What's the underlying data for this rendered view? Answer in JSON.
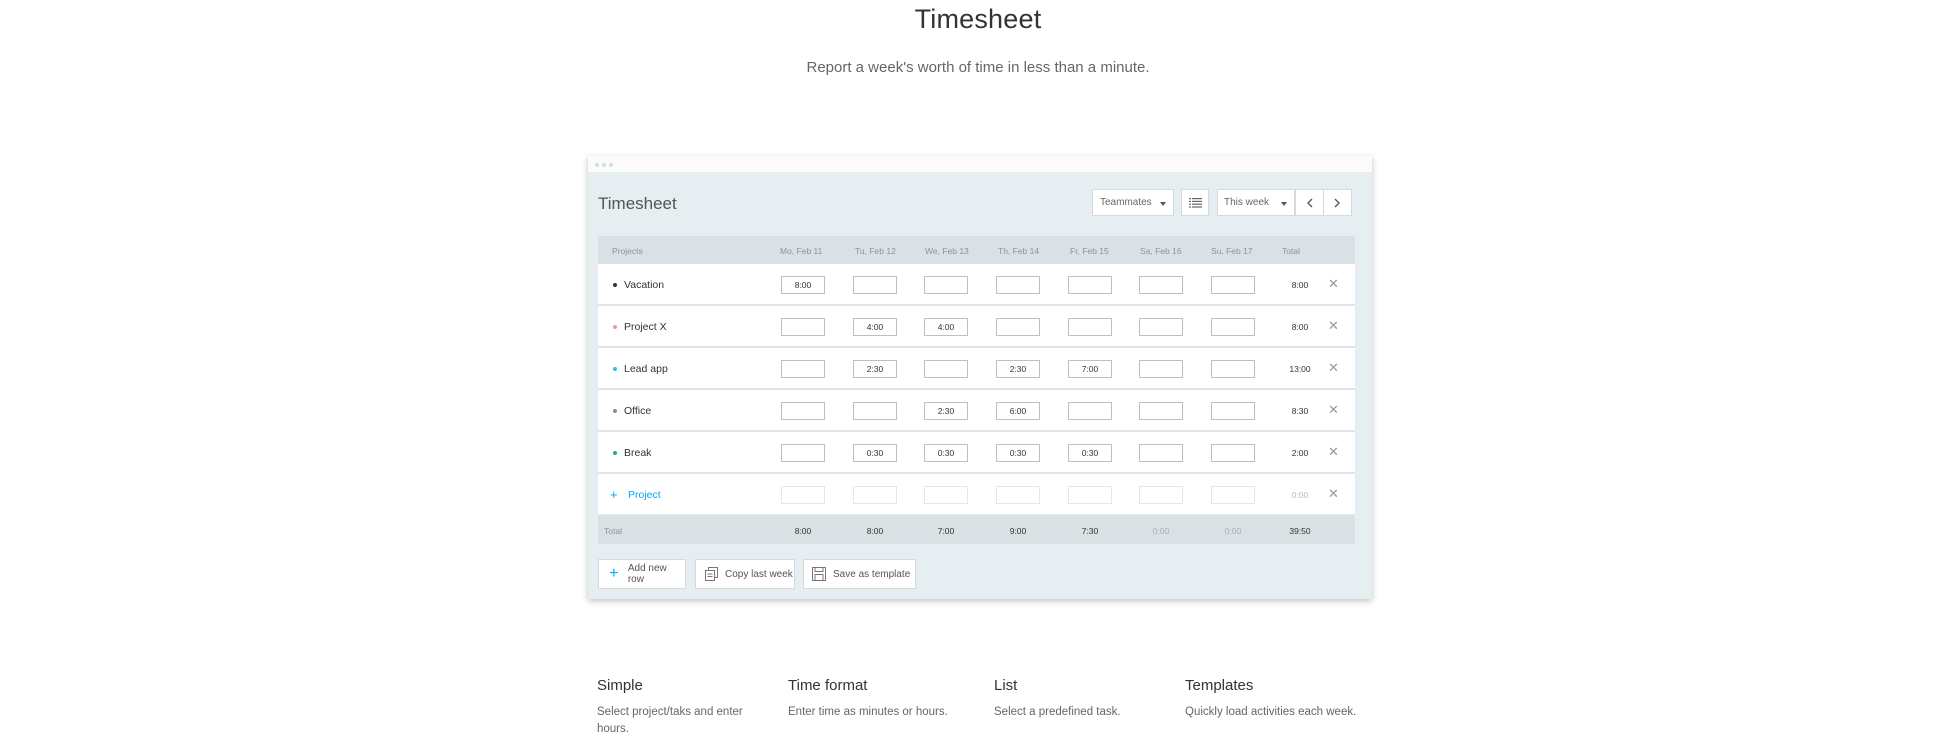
{
  "hero": {
    "title": "Timesheet",
    "subtitle": "Report a week's worth of time in less than a minute."
  },
  "app": {
    "title": "Timesheet",
    "teammates_label": "Teammates",
    "range_label": "This week",
    "prev_icon": "chevron-left-icon",
    "next_icon": "chevron-right-icon",
    "accent_color": "#03a9f4"
  },
  "table": {
    "headers": {
      "projects": "Projects",
      "days": [
        "Mo, Feb 11",
        "Tu, Feb 12",
        "We, Feb 13",
        "Th, Feb 14",
        "Fr, Feb 15",
        "Sa, Feb 16",
        "Su, Feb 17"
      ],
      "total": "Total"
    },
    "rows": [
      {
        "name": "Vacation",
        "color": "#333333",
        "cells": [
          "8:00",
          "",
          "",
          "",
          "",
          "",
          ""
        ],
        "total": "8:00"
      },
      {
        "name": "Project X",
        "color": "#f48fb1",
        "cells": [
          "",
          "4:00",
          "4:00",
          "",
          "",
          "",
          ""
        ],
        "total": "8:00"
      },
      {
        "name": "Lead app",
        "color": "#26c6da",
        "cells": [
          "",
          "2:30",
          "",
          "2:30",
          "7:00",
          "",
          ""
        ],
        "total": "13:00"
      },
      {
        "name": "Office",
        "color": "#a1887f",
        "cells": [
          "",
          "",
          "2:30",
          "6:00",
          "",
          "",
          ""
        ],
        "total": "8:30"
      },
      {
        "name": "Break",
        "color": "#26a69a",
        "cells": [
          "",
          "0:30",
          "0:30",
          "0:30",
          "0:30",
          "",
          ""
        ],
        "total": "2:00"
      }
    ],
    "add_project_label": "Project",
    "add_project_total": "0:00",
    "footer": {
      "label": "Total",
      "values": [
        "8:00",
        "8:00",
        "7:00",
        "9:00",
        "7:30",
        "0:00",
        "0:00"
      ],
      "grand_total": "39:50"
    }
  },
  "actions": {
    "add_row": "Add new row",
    "copy_week": "Copy last week",
    "save_template": "Save as template"
  },
  "features": [
    {
      "title": "Simple",
      "text": "Select project/taks and enter hours."
    },
    {
      "title": "Time format",
      "text": "Enter time as minutes or hours."
    },
    {
      "title": "List",
      "text": "Select a predefined task."
    },
    {
      "title": "Templates",
      "text": "Quickly load activities each week."
    }
  ]
}
